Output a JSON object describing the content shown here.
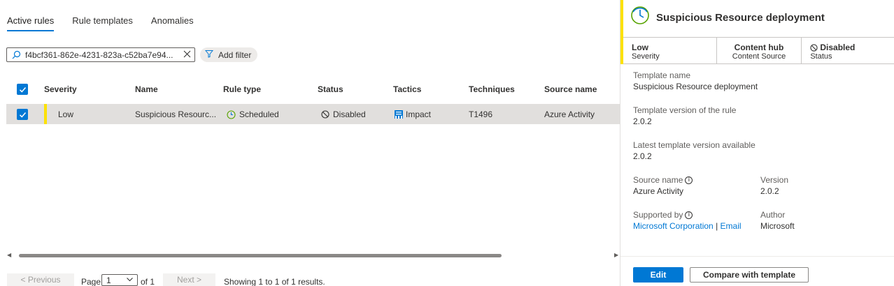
{
  "tabs": [
    {
      "label": "Active rules",
      "active": true
    },
    {
      "label": "Rule templates",
      "active": false
    },
    {
      "label": "Anomalies",
      "active": false
    }
  ],
  "search": {
    "value": "f4bcf361-862e-4231-823a-c52ba7e94...",
    "icon": "search-icon"
  },
  "filter": {
    "label": "Add filter",
    "icon": "filter-icon"
  },
  "table": {
    "columns": [
      "Severity",
      "Name",
      "Rule type",
      "Status",
      "Tactics",
      "Techniques",
      "Source name"
    ],
    "rows": [
      {
        "severity": "Low",
        "name": "Suspicious Resourc...",
        "rule_type": "Scheduled",
        "status": "Disabled",
        "tactics": "Impact",
        "techniques": "T1496",
        "source_name": "Azure Activity"
      }
    ]
  },
  "pager": {
    "previous": "< Previous",
    "page_label": "Page",
    "page_value": "1",
    "of_label": "of 1",
    "next": "Next >",
    "summary": "Showing 1 to 1 of 1 results."
  },
  "panel": {
    "title": "Suspicious Resource deployment",
    "summary": [
      {
        "value": "Low",
        "label": "Severity"
      },
      {
        "value": "Content hub",
        "label": "Content Source"
      },
      {
        "value": "Disabled",
        "label": "Status"
      }
    ],
    "template_name_label": "Template name",
    "template_name_value": "Suspicious Resource deployment",
    "template_version_label": "Template version of the rule",
    "template_version_value": "2.0.2",
    "latest_version_label": "Latest template version available",
    "latest_version_value": "2.0.2",
    "source_name_label": "Source name",
    "source_name_value": "Azure Activity",
    "version_label": "Version",
    "version_value": "2.0.2",
    "supported_by_label": "Supported by",
    "supported_by_link": "Microsoft Corporation",
    "supported_by_sep": "|",
    "supported_by_email": "Email",
    "author_label": "Author",
    "author_value": "Microsoft",
    "edit_button": "Edit",
    "compare_button": "Compare with template"
  },
  "colors": {
    "accent": "#0078d4",
    "severity_low": "#fce100",
    "selected_row": "#e1dfdd"
  }
}
